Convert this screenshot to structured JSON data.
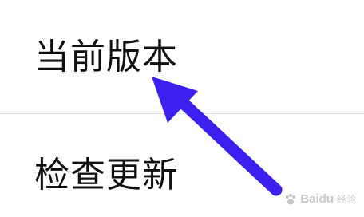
{
  "settings_list": {
    "items": [
      {
        "label": "当前版本"
      },
      {
        "label": "检查更新"
      }
    ]
  },
  "annotation": {
    "arrow_color": "#3b20f0",
    "arrow_icon": "arrow-up-left-icon"
  },
  "watermark": {
    "brand": "Bai",
    "brand_tail": "du",
    "suffix": "经验"
  }
}
